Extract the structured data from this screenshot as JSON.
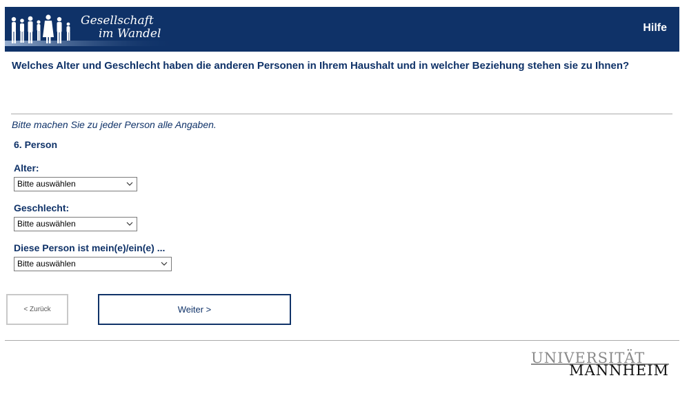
{
  "header": {
    "brand_line1": "Gesellschaft",
    "brand_line2": "im Wandel",
    "help_label": "Hilfe",
    "background_color": "#0f3268",
    "banner_icon": "people-silhouettes-icon"
  },
  "question": {
    "text": "Welches Alter und Geschlecht haben die anderen Personen in Ihrem Haushalt und in welcher Beziehung stehen sie zu Ihnen?"
  },
  "instruction": "Bitte machen Sie zu jeder Person alle Angaben.",
  "person": {
    "heading": "6. Person",
    "fields": [
      {
        "label": "Alter:",
        "selected": "Bitte auswählen"
      },
      {
        "label": "Geschlecht:",
        "selected": "Bitte auswählen"
      },
      {
        "label": "Diese Person ist mein(e)/ein(e) ...",
        "selected": "Bitte auswählen"
      }
    ]
  },
  "navigation": {
    "back_label": "< Zurück",
    "next_label": "Weiter >"
  },
  "footer": {
    "logo_word1": "UNIVERSITÄT",
    "logo_word2": "MANNHEIM"
  },
  "colors": {
    "accent": "#0f3268",
    "divider": "#a9a9a9"
  }
}
